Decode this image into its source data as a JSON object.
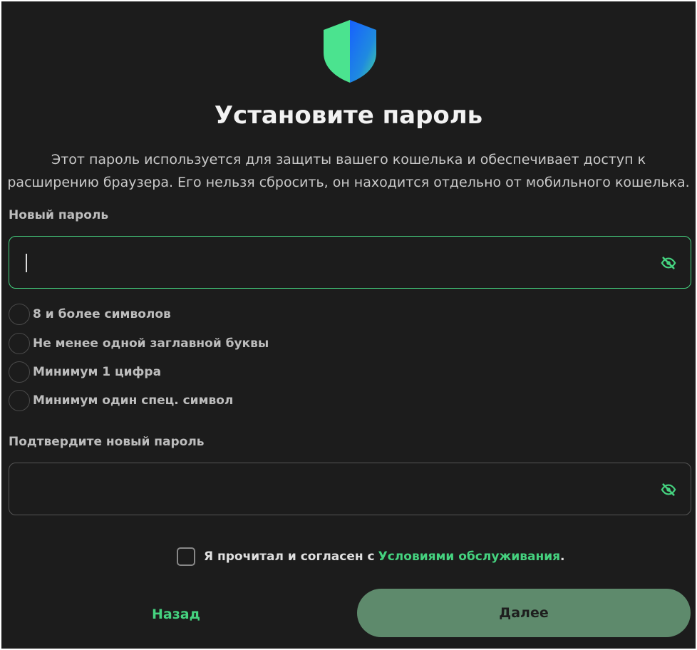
{
  "header": {
    "title": "Установите пароль",
    "description": "Этот пароль используется для защиты вашего кошелька и обеспечивает доступ к расширению браузера. Его нельзя сбросить, он находится отдельно от мобильного кошелька."
  },
  "new_password": {
    "label": "Новый пароль",
    "value": "",
    "placeholder": "",
    "toggle_icon": "eye-slash-icon"
  },
  "requirements": [
    {
      "text": "8 и более символов",
      "met": false
    },
    {
      "text": "Не менее одной заглавной буквы",
      "met": false
    },
    {
      "text": "Минимум 1 цифра",
      "met": false
    },
    {
      "text": "Минимум один спец. символ",
      "met": false
    }
  ],
  "confirm_password": {
    "label": "Подтвердите новый пароль",
    "value": "",
    "placeholder": "",
    "toggle_icon": "eye-slash-icon"
  },
  "terms": {
    "checked": false,
    "prefix": "Я прочитал и согласен с",
    "link_text": "Условиями обслуживания",
    "suffix": "."
  },
  "buttons": {
    "back_label": "Назад",
    "next_label": "Далее"
  },
  "colors": {
    "background": "#1c1c1c",
    "accent_green": "#45d27f",
    "next_button": "#5e8a6c",
    "shield_green": "#4be38f",
    "shield_blue": "#1f6fe8"
  }
}
